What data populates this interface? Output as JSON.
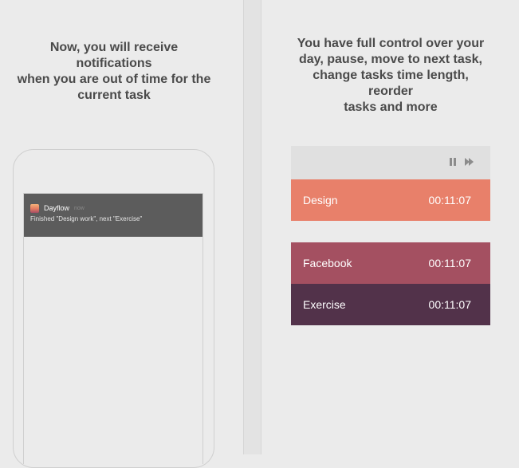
{
  "left_panel": {
    "caption": "Now, you will receive notifications\nwhen you are out of time for the\ncurrent task",
    "notification": {
      "app_name": "Dayflow",
      "time": "now",
      "message": "Finished \"Design work\", next \"Exercise\""
    }
  },
  "right_panel": {
    "caption": "You have full control over your\nday, pause, move to next task,\nchange tasks time length, reorder\ntasks and more",
    "controls": {
      "pause_icon": "pause-icon",
      "skip_icon": "skip-forward-icon"
    },
    "tasks": [
      {
        "name": "Design",
        "time": "00:11:07",
        "color": "#e8806a"
      },
      {
        "name": "Facebook",
        "time": "00:11:07",
        "color": "#a45061"
      },
      {
        "name": "Exercise",
        "time": "00:11:07",
        "color": "#52324a"
      }
    ]
  }
}
